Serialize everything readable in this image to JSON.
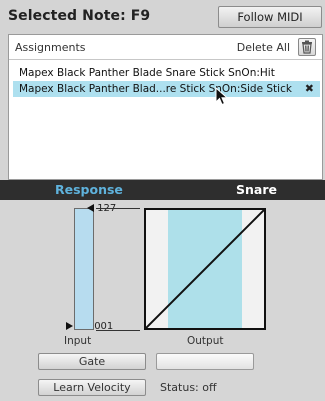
{
  "header": {
    "selected_note_label": "Selected Note: F9",
    "follow_midi_label": "Follow MIDI"
  },
  "assignments": {
    "label": "Assignments",
    "delete_all_label": "Delete All",
    "rows": [
      {
        "text": "Mapex Black Panther Blade Snare Stick SnOn:Hit",
        "selected": false
      },
      {
        "text": "Mapex Black Panther Blad...re Stick SnOn:Side Stick",
        "selected": true
      }
    ],
    "remove_glyph": "✖"
  },
  "section": {
    "left_label": "Response",
    "right_label": "Snare",
    "left_color": "#5fb2dc",
    "right_color": "#ffffff"
  },
  "response": {
    "max_mark": "127",
    "min_mark": "001",
    "input_label": "Input",
    "output_label": "Output",
    "input_fill_color": "#b7dcef",
    "curve": "linear"
  },
  "controls": {
    "gate_label": "Gate",
    "learn_velocity_label": "Learn Velocity",
    "status_text": "Status: off"
  }
}
